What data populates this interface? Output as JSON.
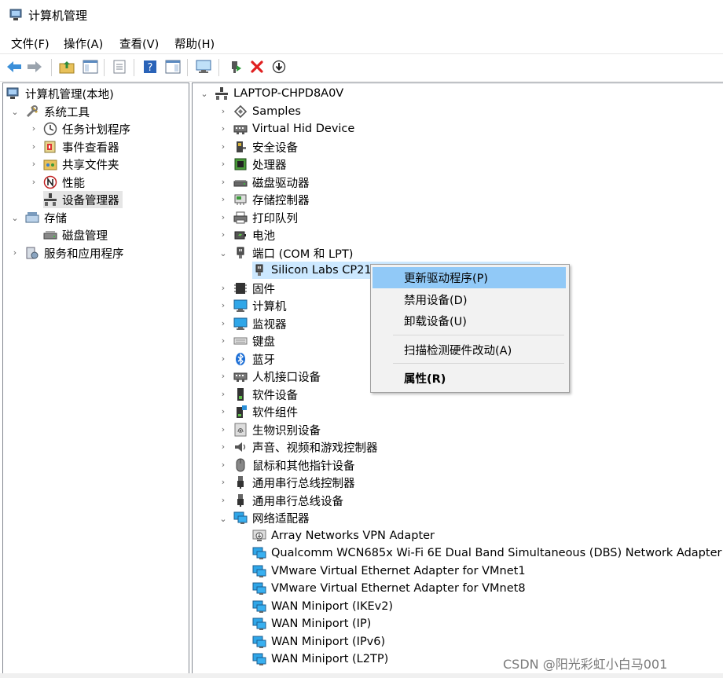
{
  "window": {
    "title": "计算机管理"
  },
  "menubar": {
    "items": [
      "文件(F)",
      "操作(A)",
      "查看(V)",
      "帮助(H)"
    ]
  },
  "tree": {
    "root": "计算机管理(本地)",
    "system_tools": "系统工具",
    "task_scheduler": "任务计划程序",
    "event_viewer": "事件查看器",
    "shared_folders": "共享文件夹",
    "performance": "性能",
    "device_manager": "设备管理器",
    "storage": "存储",
    "disk_management": "磁盘管理",
    "services_apps": "服务和应用程序"
  },
  "devices": {
    "computer_name": "LAPTOP-CHPD8A0V",
    "categories": [
      "Samples",
      "Virtual Hid Device",
      "安全设备",
      "处理器",
      "磁盘驱动器",
      "存储控制器",
      "打印队列",
      "电池",
      "端口 (COM 和 LPT)"
    ],
    "port_child": "Silicon Labs CP210",
    "categories_after": [
      "固件",
      "计算机",
      "监视器",
      "键盘",
      "蓝牙",
      "人机接口设备",
      "软件设备",
      "软件组件",
      "生物识别设备",
      "声音、视频和游戏控制器",
      "鼠标和其他指针设备",
      "通用串行总线控制器",
      "通用串行总线设备",
      "网络适配器"
    ],
    "network_adapters": [
      "Array Networks VPN Adapter",
      "Qualcomm WCN685x Wi-Fi 6E Dual Band Simultaneous (DBS) Network Adapter",
      "VMware Virtual Ethernet Adapter for VMnet1",
      "VMware Virtual Ethernet Adapter for VMnet8",
      "WAN Miniport (IKEv2)",
      "WAN Miniport (IP)",
      "WAN Miniport (IPv6)",
      "WAN Miniport (L2TP)"
    ]
  },
  "context_menu": {
    "update_driver": "更新驱动程序(P)",
    "disable_device": "禁用设备(D)",
    "uninstall_device": "卸载设备(U)",
    "scan_hardware": "扫描检测硬件改动(A)",
    "properties": "属性(R)"
  },
  "watermark": "CSDN @阳光彩虹小白马001"
}
